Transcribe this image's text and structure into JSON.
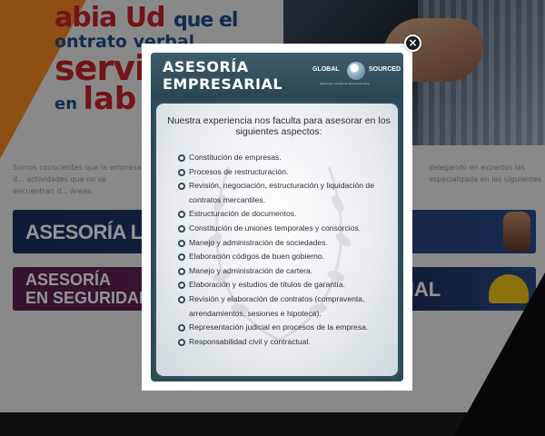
{
  "background": {
    "hero": {
      "line1": "abia Ud",
      "line1_small": "que el",
      "line2": "ontrato verbal",
      "line3": "servici",
      "line4_small": "en",
      "line4_big": "lab"
    },
    "intro_left": "Somos conscientes que la empresa d... actividades que no se encuentran d... áreas:",
    "intro_right": "delegando en expertos las especializada en las siguientes",
    "banners": [
      {
        "label": "ASESORÍA LABOR"
      },
      {
        "label_line1": "ASESORÍA",
        "label_line2": "EN SEGURIDAD SOC"
      },
      {
        "label": "NAL"
      }
    ]
  },
  "modal": {
    "close_label": "×",
    "header": {
      "title_line1": "ASESORÍA",
      "title_line2": "EMPRESARIAL",
      "brand_left": "GLOBAL",
      "brand_right": "SOURCED",
      "brand_tagline": "Asesores Jurídicos Empresariales"
    },
    "intro": "Nuestra experiencia nos faculta para asesorar en los siguientes aspectos:",
    "items": [
      "Constitución de empresas.",
      "Procesos de restructuración.",
      "Revisión, negociación, estructuración y liquidación de contratos mercantiles.",
      "Estructuración de documentos.",
      "Constitución de uniones temporales y consorcios.",
      "Manejo y administración de sociedades.",
      "Elaboración códigos de buen gobierno.",
      "Manejo y administración de cartera.",
      "Elaboración y estudios de títulos de garantía.",
      "Revisión y elaboración de contratos (compraventa, arrendamientos, sesiones e hipoteca).",
      "Representación judicial en procesos de la empresa.",
      "Responsabilidad civil y contractual."
    ]
  },
  "colors": {
    "accent_orange": "#f7871f",
    "card_teal": "#2d4a57",
    "overlay": "rgba(0,0,0,0.42)"
  }
}
